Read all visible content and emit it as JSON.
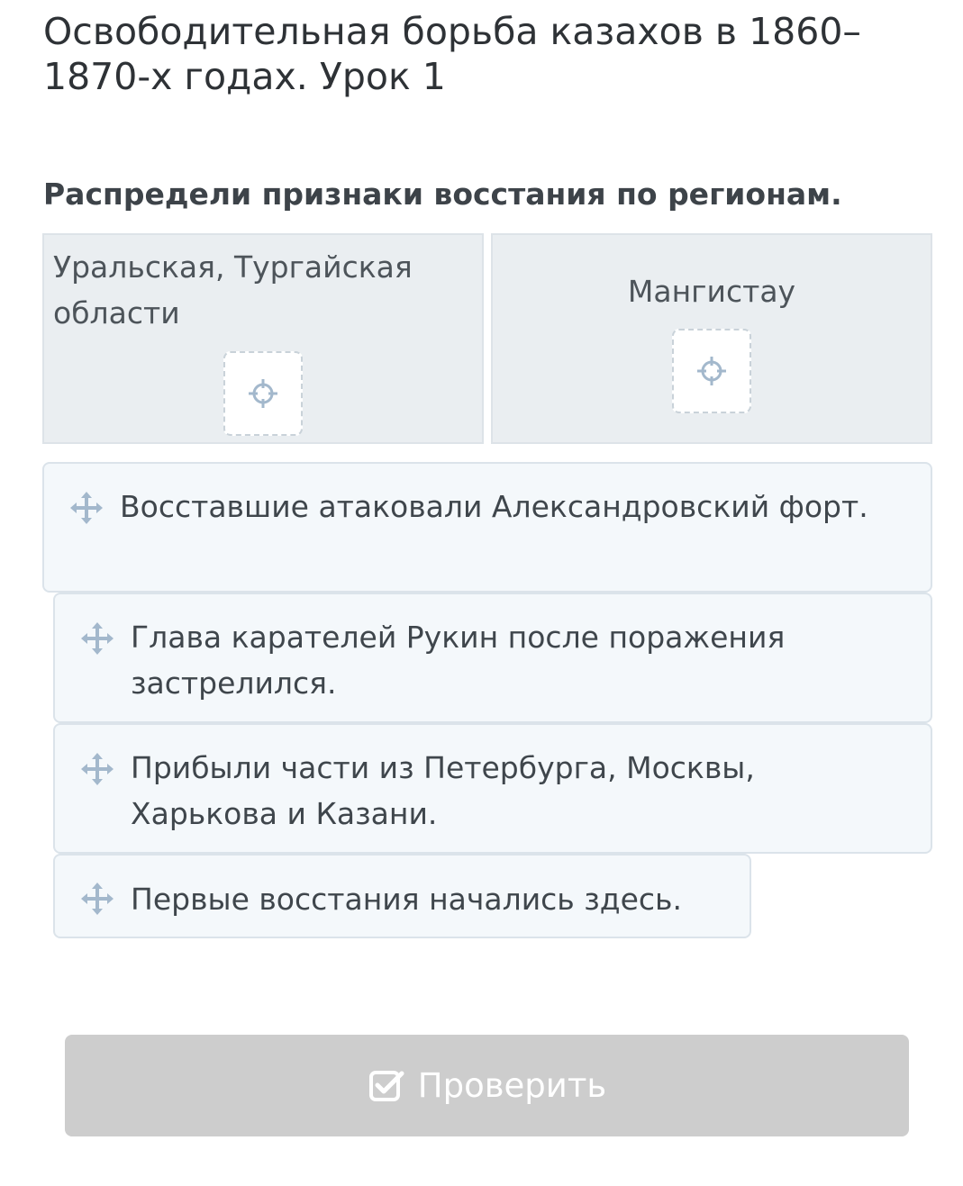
{
  "lesson": {
    "title": "Освободительная борьба казахов в 1860–1870-х годах. Урок 1"
  },
  "task": {
    "instruction": "Распредели признаки восстания по регионам."
  },
  "drop_zones": [
    {
      "label": "Уральская, Тургайская области",
      "slot_icon": "crosshair-icon"
    },
    {
      "label": "Мангистау",
      "slot_icon": "crosshair-icon"
    }
  ],
  "cards": [
    {
      "text": "Восставшие атаковали Александровский форт.",
      "icon": "move-icon"
    },
    {
      "text": "Глава карателей Рукин после поражения застрелился.",
      "icon": "move-icon"
    },
    {
      "text": "Прибыли части из Петербурга, Москвы, Харькова и Казани.",
      "icon": "move-icon"
    },
    {
      "text": "Первые восстания начались здесь.",
      "icon": "move-icon"
    }
  ],
  "check_button": {
    "label": "Проверить",
    "icon": "check-square-icon",
    "state": "disabled"
  },
  "colors": {
    "zone_bg": "#eaeef1",
    "card_bg": "#f4f8fb",
    "icon_blue": "#a3b8cc",
    "button_disabled": "#cdcdcd"
  }
}
